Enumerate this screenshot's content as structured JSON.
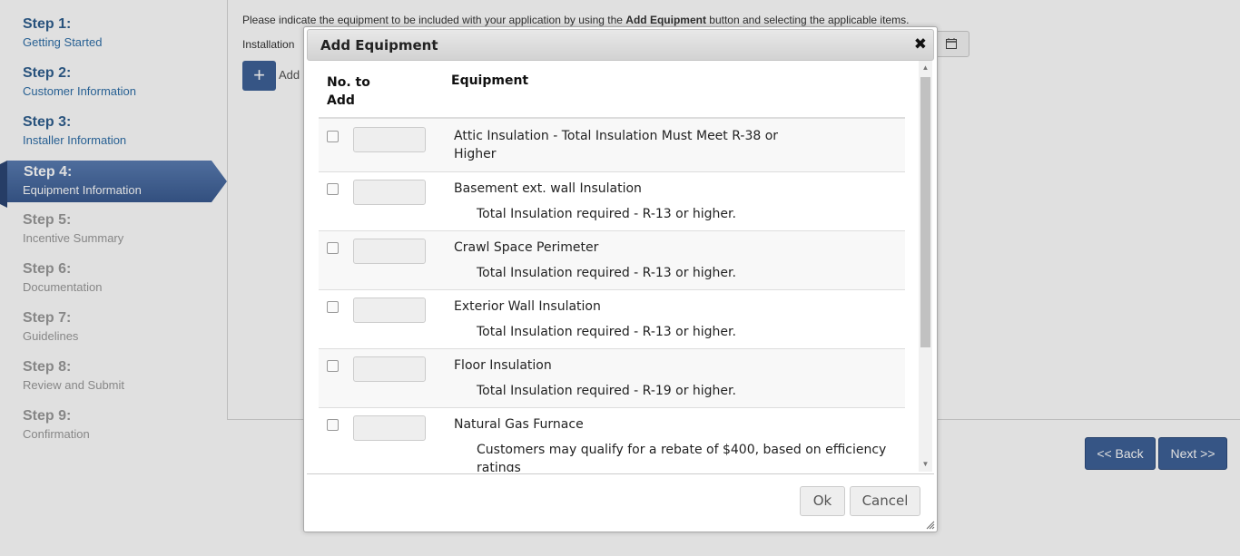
{
  "sidebar": {
    "steps": [
      {
        "num": "Step 1:",
        "label": "Getting Started"
      },
      {
        "num": "Step 2:",
        "label": "Customer Information"
      },
      {
        "num": "Step 3:",
        "label": "Installer Information"
      },
      {
        "num": "Step 4:",
        "label": "Equipment Information"
      },
      {
        "num": "Step 5:",
        "label": "Incentive Summary"
      },
      {
        "num": "Step 6:",
        "label": "Documentation"
      },
      {
        "num": "Step 7:",
        "label": "Guidelines"
      },
      {
        "num": "Step 8:",
        "label": "Review and Submit"
      },
      {
        "num": "Step 9:",
        "label": "Confirmation"
      }
    ],
    "active_index": 3
  },
  "main": {
    "instructions_pre": "Please indicate the equipment to be included with your application by using the ",
    "instructions_bold": "Add Equipment",
    "instructions_post": " button and selecting the applicable items.",
    "installation_label": "Installation",
    "add_button_glyph": "+",
    "add_label": "Add",
    "calendar_icon": "calendar-icon",
    "back_button": "<< Back",
    "next_button": "Next >>"
  },
  "dialog": {
    "title": "Add Equipment",
    "close_glyph": "✖",
    "columns": {
      "qty_line1": "No. to",
      "qty_line2": "Add",
      "equipment": "Equipment"
    },
    "rows": [
      {
        "name_line1": "Attic Insulation - Total Insulation Must Meet R-38 or",
        "name_line2": "Higher",
        "desc": "",
        "checked": false,
        "qty": ""
      },
      {
        "name_line1": "Basement ext. wall Insulation",
        "name_line2": "",
        "desc": "Total Insulation required - R-13 or higher.",
        "checked": false,
        "qty": ""
      },
      {
        "name_line1": "Crawl Space Perimeter",
        "name_line2": "",
        "desc": "Total Insulation required - R-13 or higher.",
        "checked": false,
        "qty": ""
      },
      {
        "name_line1": "Exterior Wall Insulation",
        "name_line2": "",
        "desc": "Total Insulation required - R-13 or higher.",
        "checked": false,
        "qty": ""
      },
      {
        "name_line1": "Floor Insulation",
        "name_line2": "",
        "desc": "Total Insulation required - R-19 or higher.",
        "checked": false,
        "qty": ""
      },
      {
        "name_line1": "Natural Gas Furnace",
        "name_line2": "",
        "desc": "Customers may qualify for a rebate of $400, based on efficiency",
        "desc_line2": "ratings",
        "checked": false,
        "qty": ""
      }
    ],
    "ok_button": "Ok",
    "cancel_button": "Cancel"
  }
}
